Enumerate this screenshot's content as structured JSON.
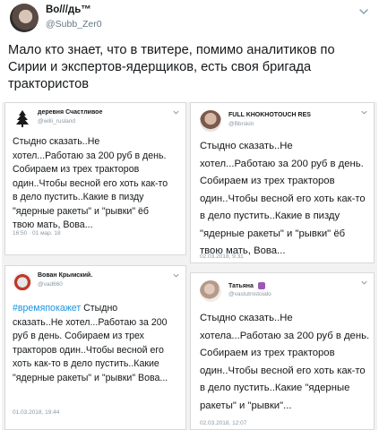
{
  "tweet": {
    "display_name": "Во///дь™",
    "handle": "@Subb_Zer0",
    "text": "Мало кто знает, что в твитере, помимо аналитиков по Сирии и экспертов-ядерщиков, есть своя бригада трактористов"
  },
  "cards": [
    {
      "name": "деревня Счастливое",
      "handle": "@willi_rusland",
      "lines": [
        "Стыдно сказать..Не",
        "хотел...Работаю за 200 руб в день.",
        "Собираем из трех тракторов",
        "один..Чтобы весной его хоть как-то",
        "в дело пустить..Какие в пизду",
        "\"ядерные ракеты\" и \"рывки\" ёб",
        "твою мать, Вова..."
      ],
      "time": "16:50 · 01 мар. 18"
    },
    {
      "name": "FULL KHOKHOTOUCH RES",
      "handle": "@Bbrskin",
      "lines": [
        "Стыдно сказать..Не",
        "хотел...Работаю за 200 руб в день.",
        "Собираем из трех тракторов",
        "один..Чтобы весной его хоть как-то",
        "в дело пустить..Какие в  пизду",
        "\"ядерные ракеты\" и \"рывки\" ёб",
        "твою мать, Вова..."
      ],
      "time": "02.03.2018, 9:31"
    },
    {
      "name": "Вован Крымский.",
      "handle": "@vad660",
      "hashtag": "#времяпокажет",
      "first_line_rest": " Стыдно",
      "lines": [
        "сказать..Не хотел...Работаю за 200",
        "руб в день. Собираем из трех",
        "тракторов один..Чтобы весной его",
        "хоть как-то в дело пустить..Какие",
        "\"ядерные ракеты\" и \"рывки\" Вова..."
      ],
      "time": "01.03.2018, 19:44"
    },
    {
      "name": "Татьяна",
      "handle": "@vastutnistoialo",
      "lines": [
        "Стыдно сказать..Не",
        "хотела...Работаю за 200 руб в день.",
        "Собираем из трех  тракторов",
        "один..Чтобы весной его хоть как-то",
        "в дело пустить..Какие  \"ядерные",
        "ракеты\" и \"рывки\"..."
      ],
      "time": "02.03.2018, 12:07"
    }
  ]
}
